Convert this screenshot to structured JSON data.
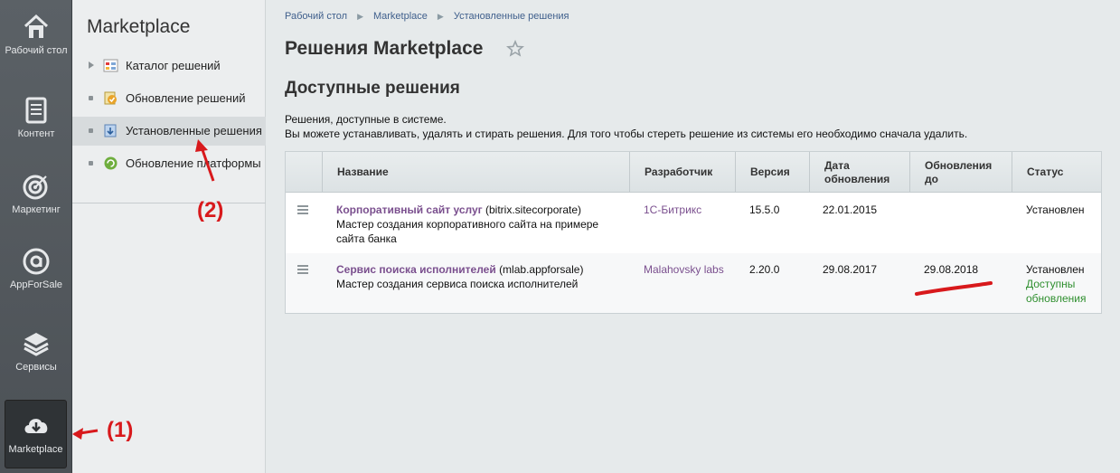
{
  "rail": {
    "items": [
      {
        "label": "Рабочий стол",
        "icon": "home-icon"
      },
      {
        "label": "Контент",
        "icon": "document-icon"
      },
      {
        "label": "Маркетинг",
        "icon": "target-icon"
      },
      {
        "label": "AppForSale",
        "icon": "appforsale-icon"
      },
      {
        "label": "Сервисы",
        "icon": "layers-icon"
      },
      {
        "label": "Marketplace",
        "icon": "cloud-download-icon"
      }
    ]
  },
  "menu": {
    "title": "Marketplace",
    "items": [
      {
        "label": "Каталог решений"
      },
      {
        "label": "Обновление решений"
      },
      {
        "label": "Установленные решения"
      },
      {
        "label": "Обновление платформы"
      }
    ]
  },
  "breadcrumb": [
    "Рабочий стол",
    "Marketplace",
    "Установленные решения"
  ],
  "page": {
    "title": "Решения Marketplace",
    "subtitle": "Доступные решения",
    "desc1": "Решения, доступные в системе.",
    "desc2": "Вы можете устанавливать, удалять и стирать решения. Для того чтобы стереть решение из системы его необходимо сначала удалить."
  },
  "table": {
    "headers": [
      "Название",
      "Разработчик",
      "Версия",
      "Дата обновления",
      "Обновления до",
      "Статус"
    ],
    "rows": [
      {
        "name": "Корпоративный сайт услуг",
        "code": "(bitrix.sitecorporate)",
        "desc": "Мастер создания корпоративного сайта на примере сайта банка",
        "developer": "1С-Битрикс",
        "version": "15.5.0",
        "date": "22.01.2015",
        "until": "",
        "status": "Установлен",
        "status_extra": ""
      },
      {
        "name": "Сервис поиска исполнителей",
        "code": "(mlab.appforsale)",
        "desc": "Мастер создания сервиса поиска исполнителей",
        "developer": "Malahovsky labs",
        "version": "2.20.0",
        "date": "29.08.2017",
        "until": "29.08.2018",
        "status": "Установлен",
        "status_extra": "Доступны обновления"
      }
    ]
  },
  "annotations": {
    "one": "(1)",
    "two": "(2)"
  },
  "colors": {
    "accent_red": "#d8191c",
    "link_purple": "#7a4f8e",
    "ok_green": "#2f8f2f"
  }
}
